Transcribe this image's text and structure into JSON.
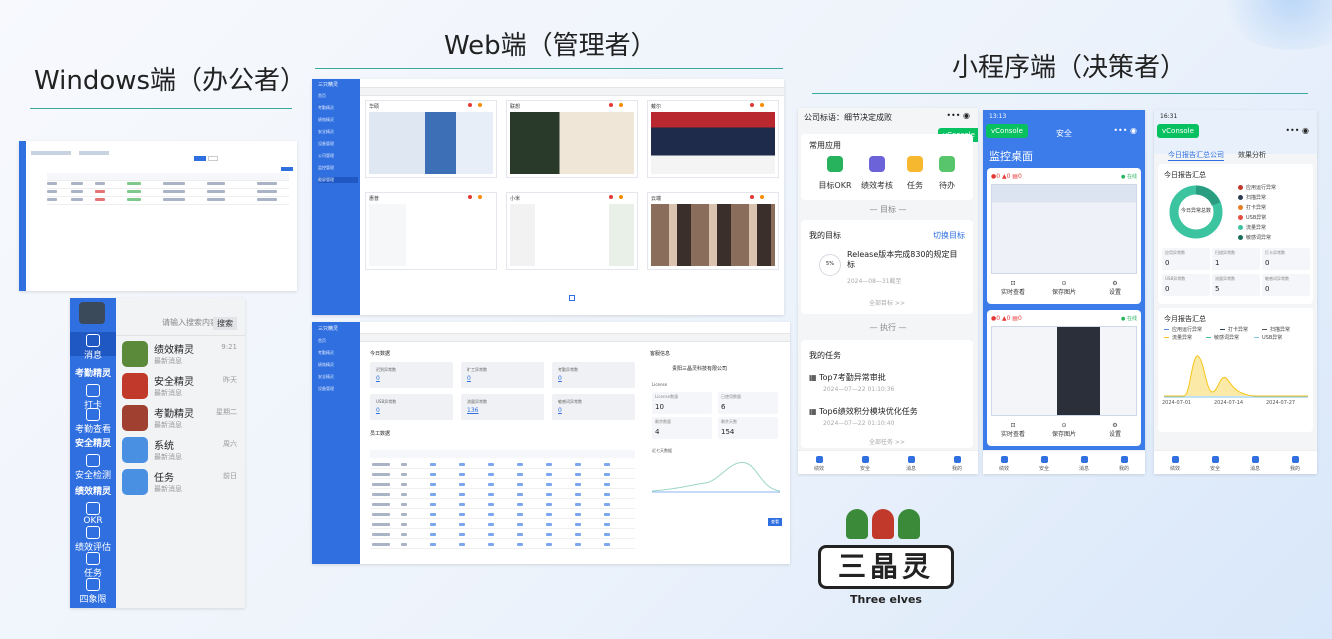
{
  "headings": {
    "windows": "Windows端（办公者）",
    "web": "Web端（管理者）",
    "mini": "小程序端（决策者）"
  },
  "chat": {
    "search_placeholder": "请输入搜索内容",
    "search_btn": "搜索",
    "nav_message": "消息",
    "sec_attendance": "考勤精灵",
    "nav_punch": "打卡",
    "nav_att_check": "考勤查看",
    "sec_security": "安全精灵",
    "nav_sec_check": "安全检测",
    "sec_perf": "绩效精灵",
    "nav_okr": "OKR",
    "nav_perf_eval": "绩效评估",
    "nav_task": "任务",
    "nav_weekly": "四象限",
    "items": [
      {
        "name": "绩效精灵",
        "msg": "最新消息",
        "time": "9:21"
      },
      {
        "name": "安全精灵",
        "msg": "最新消息",
        "time": "昨天"
      },
      {
        "name": "考勤精灵",
        "msg": "最新消息",
        "time": "星期二"
      },
      {
        "name": "系统",
        "msg": "最新消息",
        "time": "周六"
      },
      {
        "name": "任务",
        "msg": "最新消息",
        "time": "前日"
      }
    ]
  },
  "web": {
    "brand": "三只精灵",
    "menu": [
      "首页",
      "考勤精灵",
      "绩效精灵",
      "安全精灵",
      "设备管理",
      "公司管理",
      "监控管理",
      "截屏管理"
    ],
    "cams": [
      "华硕",
      "联想",
      "戴尔",
      "惠普",
      "小米",
      "云端"
    ],
    "dash_title": "今日数据",
    "stats": [
      {
        "label": "迟到异常数",
        "value": "0"
      },
      {
        "label": "旷工异常数",
        "value": "0"
      },
      {
        "label": "考勤异常数",
        "value": "0"
      },
      {
        "label": "USB异常数",
        "value": "0"
      },
      {
        "label": "流量异常数",
        "value": "136"
      },
      {
        "label": "敏感词异常数",
        "value": "0"
      }
    ],
    "notice_title": "客服信息",
    "company": "贵阳三晶灵科技有限公司",
    "license": "License",
    "side_stats": [
      {
        "label": "License数量",
        "value": "10"
      },
      {
        "label": "已使用数量",
        "value": "6"
      },
      {
        "label": "剩余数量",
        "value": "4"
      },
      {
        "label": "剩余天数",
        "value": "154"
      }
    ],
    "week_title": "近七天数据",
    "emp_title": "员工数据",
    "notice_btn": "查看"
  },
  "mini": {
    "p1": {
      "company": "公司标语：细节决定成败",
      "apps_title": "常用应用",
      "apps": [
        "目标OKR",
        "绩效考核",
        "任务",
        "待办"
      ],
      "sec_goal": "目标",
      "goal_title": "我的目标",
      "goal_switch": "切换目标",
      "goal_pct": "5%",
      "goal_text": "Release版本完成830的规定目标",
      "goal_date": "2024—08—31截至",
      "goal_more": "全部目标 >>",
      "sec_exec": "执行",
      "task_title": "我的任务",
      "tasks": [
        {
          "name": "Top7考勤异常审批",
          "date": "2024—07—22 01:10:36"
        },
        {
          "name": "Top6绩效积分模块优化任务",
          "date": "2024—07—22 01:10:40"
        }
      ],
      "task_more": "全部任务 >>",
      "tabs": [
        "绩效",
        "安全",
        "消息",
        "我的"
      ]
    },
    "p2": {
      "time": "13:13",
      "title": "安全",
      "vconsole": "vConsole",
      "desk": "监控桌面",
      "online": "在线",
      "foot": [
        "实时查看",
        "保存图片",
        "设置"
      ],
      "tabs": [
        "绩效",
        "安全",
        "消息",
        "我的"
      ]
    },
    "p3": {
      "time": "16:31",
      "vconsole": "vConsole",
      "tab1": "今日报告汇总公司",
      "tab2": "效果分析",
      "daily_title": "今日报告汇总",
      "donut_label": "今日异常总数",
      "legend": [
        "应用运行异常",
        "扫描异常",
        "打卡异常",
        "USB异常",
        "流量异常",
        "敏感词异常"
      ],
      "boxes": [
        {
          "label": "应用异常数",
          "value": "0"
        },
        {
          "label": "扫描异常数",
          "value": "1"
        },
        {
          "label": "打卡异常数",
          "value": "0"
        },
        {
          "label": "USB异常数",
          "value": "0"
        },
        {
          "label": "流量异常数",
          "value": "5"
        },
        {
          "label": "敏感词异常数",
          "value": "0"
        }
      ],
      "monthly_title": "今月报告汇总",
      "month_legend": [
        "应用运行异常",
        "打卡异常",
        "扫描异常",
        "流量异常",
        "敏感词异常",
        "USB异常"
      ],
      "dates": [
        "2024-07-01",
        "2024-07-14",
        "2024-07-27"
      ],
      "tabs": [
        "绩效",
        "安全",
        "消息",
        "我的"
      ]
    }
  },
  "logo": {
    "cn": "三晶灵",
    "en": "Three elves"
  },
  "colors": {
    "accent": "#2f6fe0",
    "teal": "#3aa9a0",
    "green": "#07c160"
  }
}
